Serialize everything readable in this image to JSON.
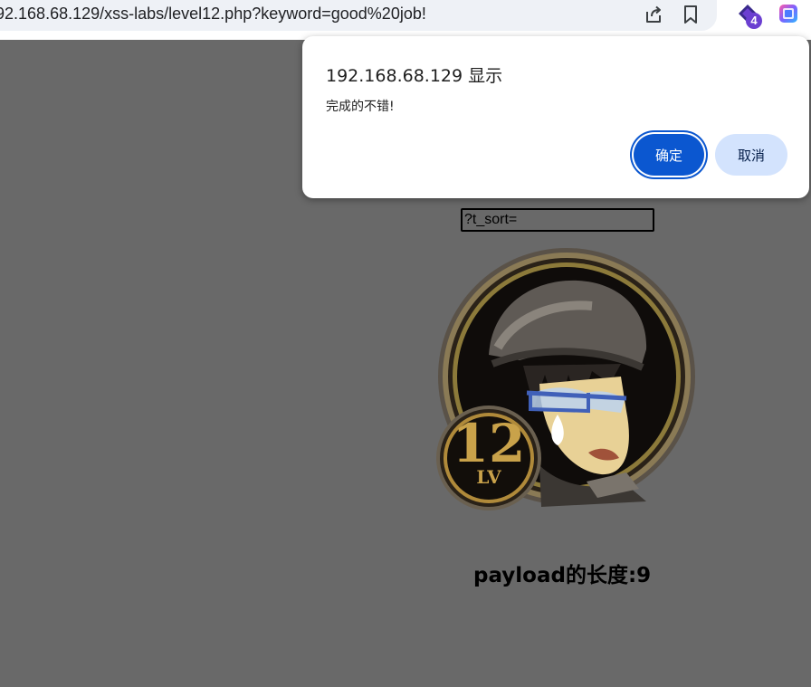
{
  "browser": {
    "url": "/192.168.68.129/xss-labs/level12.php?keyword=good%20job!",
    "extension_badge": "4"
  },
  "page": {
    "search_input_value": "?t_sort=",
    "avatar": {
      "level_number": "12",
      "level_label": "LV"
    },
    "payload_text": "payload的长度:9"
  },
  "dialog": {
    "title": "192.168.68.129 显示",
    "message": "完成的不错!",
    "ok_label": "确定",
    "cancel_label": "取消"
  },
  "colors": {
    "overlay": "#696969",
    "primary_button": "#0b57d0",
    "secondary_button": "#d3e3fd",
    "omnibox": "#eef1f6"
  },
  "icons": [
    "share-icon",
    "bookmark-icon",
    "extension-icon",
    "extension-2-icon"
  ]
}
